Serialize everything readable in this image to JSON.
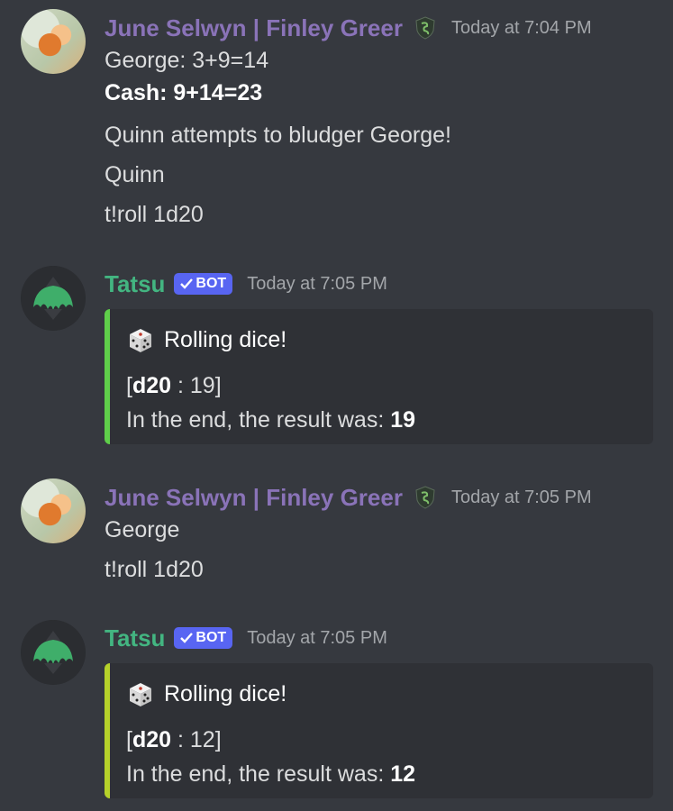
{
  "colors": {
    "background": "#36393f",
    "user_name": "#8a73b8",
    "bot_name": "#43b581",
    "bot_tag": "#5865f2",
    "embed_bg": "#2f3136",
    "embed_border_1": "#5fcf4a",
    "embed_border_2": "#b6d22a"
  },
  "icons": {
    "user_badge": "slytherin-crest-icon",
    "bot_check": "checkmark-icon",
    "dice": "dice-icon"
  },
  "messages": [
    {
      "username": "June Selwyn | Finley Greer",
      "timestamp": "Today at 7:04 PM",
      "lines": [
        "George: 3+9=14",
        "Cash: 9+14=23",
        "Quinn attempts to bludger George!",
        "Quinn",
        "t!roll 1d20"
      ]
    },
    {
      "username": "Tatsu",
      "bot_tag": "BOT",
      "timestamp": "Today at 7:05 PM",
      "embed": {
        "title": "Rolling dice!",
        "roll_open": "[",
        "roll_die": "d20",
        "roll_sep": " : ",
        "roll_value": "19",
        "roll_close": "]",
        "result_prefix": "In the end, the result was: ",
        "result_value": "19"
      }
    },
    {
      "username": "June Selwyn | Finley Greer",
      "timestamp": "Today at 7:05 PM",
      "lines": [
        "George",
        "t!roll 1d20"
      ]
    },
    {
      "username": "Tatsu",
      "bot_tag": "BOT",
      "timestamp": "Today at 7:05 PM",
      "embed": {
        "title": "Rolling dice!",
        "roll_open": "[",
        "roll_die": "d20",
        "roll_sep": " : ",
        "roll_value": "12",
        "roll_close": "]",
        "result_prefix": "In the end, the result was: ",
        "result_value": "12"
      }
    }
  ]
}
